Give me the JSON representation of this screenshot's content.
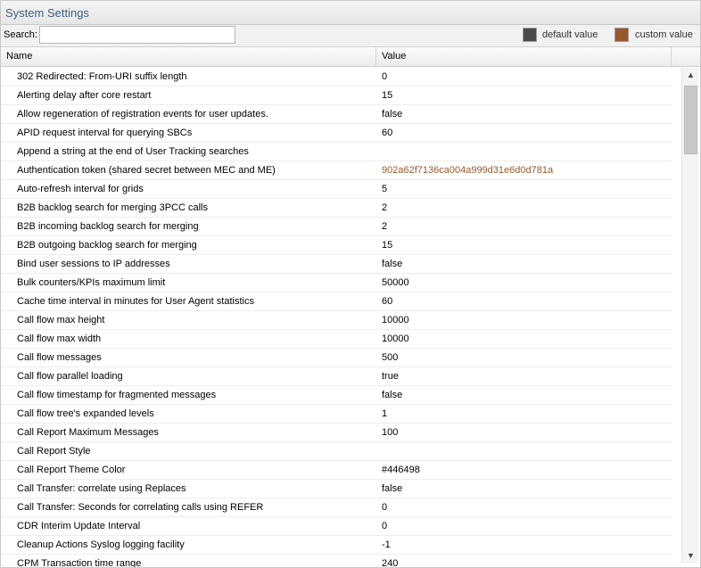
{
  "panel": {
    "title": "System Settings"
  },
  "toolbar": {
    "search_label": "Search:",
    "search_value": "",
    "legend": {
      "default_label": "default value",
      "custom_label": "custom value",
      "default_color": "#4a4a4a",
      "custom_color": "#99582a"
    }
  },
  "table": {
    "columns": [
      "Name",
      "Value"
    ],
    "rows": [
      {
        "name": "302 Redirected: From-URI suffix length",
        "value": "0"
      },
      {
        "name": "Alerting delay after core restart",
        "value": "15"
      },
      {
        "name": "Allow regeneration of registration events for user updates.",
        "value": "false"
      },
      {
        "name": "APID request interval for querying SBCs",
        "value": "60"
      },
      {
        "name": "Append a string at the end of User Tracking searches",
        "value": ""
      },
      {
        "name": "Authentication token (shared secret between MEC and ME)",
        "value": "902a62f7136ca004a999d31e6d0d781a"
      },
      {
        "name": "Auto-refresh interval for grids",
        "value": "5"
      },
      {
        "name": "B2B backlog search for merging 3PCC calls",
        "value": "2"
      },
      {
        "name": "B2B incoming backlog search for merging",
        "value": "2"
      },
      {
        "name": "B2B outgoing backlog search for merging",
        "value": "15"
      },
      {
        "name": "Bind user sessions to IP addresses",
        "value": "false"
      },
      {
        "name": "Bulk counters/KPIs maximum limit",
        "value": "50000"
      },
      {
        "name": "Cache time interval in minutes for User Agent statistics",
        "value": "60"
      },
      {
        "name": "Call flow max height",
        "value": "10000"
      },
      {
        "name": "Call flow max width",
        "value": "10000"
      },
      {
        "name": "Call flow messages",
        "value": "500"
      },
      {
        "name": "Call flow parallel loading",
        "value": "true"
      },
      {
        "name": "Call flow timestamp for fragmented messages",
        "value": "false"
      },
      {
        "name": "Call flow tree's expanded levels",
        "value": "1"
      },
      {
        "name": "Call Report Maximum Messages",
        "value": "100"
      },
      {
        "name": "Call Report Style",
        "value": ""
      },
      {
        "name": "Call Report Theme Color",
        "value": "#446498"
      },
      {
        "name": "Call Transfer: correlate using Replaces",
        "value": "false"
      },
      {
        "name": "Call Transfer: Seconds for correlating calls using REFER",
        "value": "0"
      },
      {
        "name": "CDR Interim Update Interval",
        "value": "0"
      },
      {
        "name": "Cleanup Actions Syslog logging facility",
        "value": "-1"
      },
      {
        "name": "CPM Transaction time range",
        "value": "240"
      }
    ]
  }
}
